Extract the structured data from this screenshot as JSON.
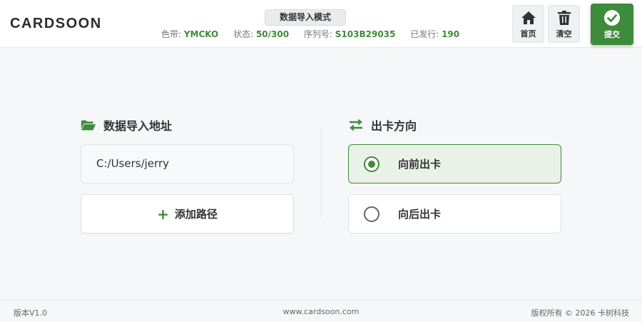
{
  "header": {
    "brand": "CARDSOON",
    "mode": "数据导入模式",
    "status": [
      {
        "label": "色带: ",
        "value": "YMCKO"
      },
      {
        "label": "状态: ",
        "value": "50/300"
      },
      {
        "label": "序列号: ",
        "value": "S103B29035"
      },
      {
        "label": "已发行: ",
        "value": "190"
      }
    ],
    "home_label": "首页",
    "clear_label": "清空",
    "submit_label": "提交"
  },
  "import": {
    "title": "数据导入地址",
    "path": "C:/Users/jerry",
    "add_label": "添加路径"
  },
  "direction": {
    "title": "出卡方向",
    "options": [
      {
        "label": "向前出卡",
        "selected": true
      },
      {
        "label": "向后出卡",
        "selected": false
      }
    ]
  },
  "footer": {
    "version": "版本V1.0",
    "site": "www.cardsoon.com",
    "copyright": "版权所有 © 2026 卡树科技"
  },
  "colors": {
    "accent": "#3e8b3b",
    "background": "#f6f7f8"
  }
}
